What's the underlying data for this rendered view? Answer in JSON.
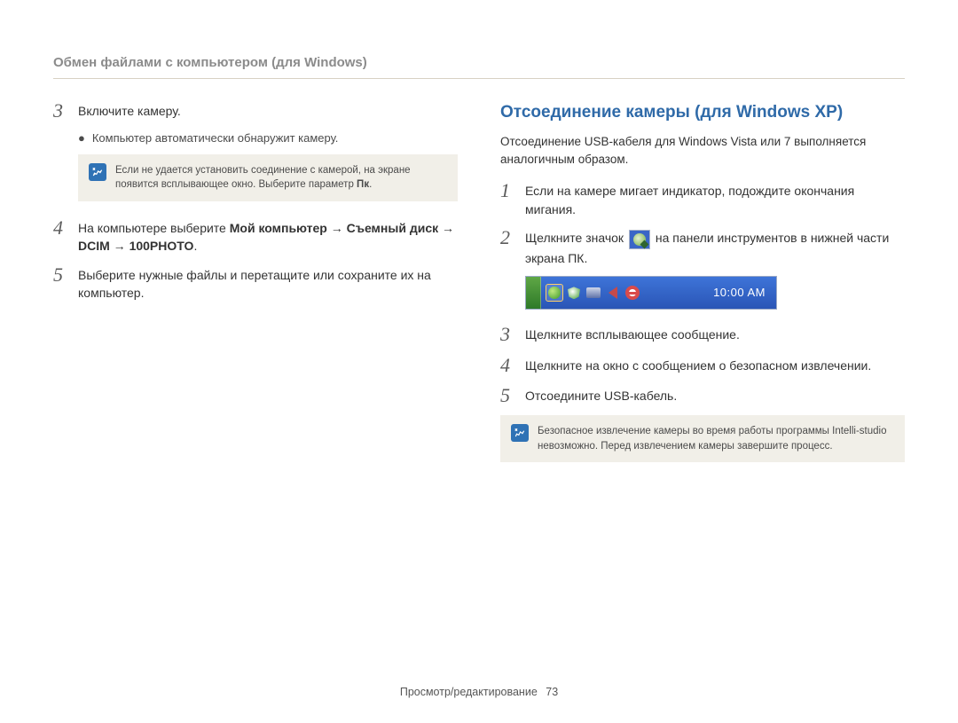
{
  "header": {
    "title": "Обмен файлами с компьютером (для Windows)"
  },
  "left": {
    "step3": {
      "num": "3",
      "text": "Включите камеру."
    },
    "bullet3": "Компьютер автоматически обнаружит камеру.",
    "note1_l1": "Если не удается установить соединение с камерой, на экране",
    "note1_l2a": "появится всплывающее окно. Выберите параметр ",
    "note1_l2b": "Пк",
    "note1_l2c": ".",
    "step4": {
      "num": "4",
      "pre": "На компьютере выберите ",
      "bold1": "Мой компьютер",
      "arrow": " → ",
      "bold2": "Съемный диск",
      "bold3": "DCIM",
      "bold4": "100PHOTO",
      "dot": "."
    },
    "step5": {
      "num": "5",
      "text": "Выберите нужные файлы и перетащите или сохраните их на компьютер."
    }
  },
  "right": {
    "title": "Отсоединение камеры (для Windows XP)",
    "intro": "Отсоединение USB-кабеля для Windows Vista или 7 выполняется аналогичным образом.",
    "step1": {
      "num": "1",
      "text": "Если на камере мигает индикатор, подождите окончания мигания."
    },
    "step2": {
      "num": "2",
      "pre": "Щелкните значок ",
      "post": " на панели инструментов в нижней части экрана ПК."
    },
    "taskbar_time": "10:00 AM",
    "step3": {
      "num": "3",
      "text": "Щелкните всплывающее сообщение."
    },
    "step4": {
      "num": "4",
      "text": "Щелкните на окно с сообщением о безопасном извлечении."
    },
    "step5": {
      "num": "5",
      "text": "Отсоедините USB-кабель."
    },
    "note2": "Безопасное извлечение камеры во время работы программы Intelli-studio невозможно. Перед извлечением камеры завершите процесс."
  },
  "footer": {
    "section": "Просмотр/редактирование",
    "page": "73"
  }
}
